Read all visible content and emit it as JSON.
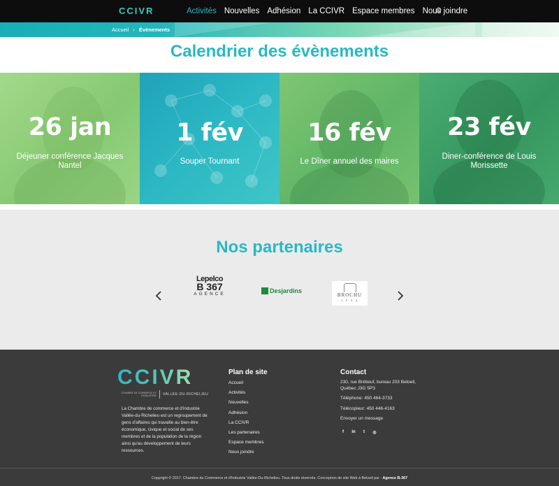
{
  "header": {
    "logo": "CCIVR",
    "nav": [
      {
        "label": "Activités",
        "active": true
      },
      {
        "label": "Nouvelles",
        "active": false
      },
      {
        "label": "Adhésion",
        "active": false
      },
      {
        "label": "La CCIVR",
        "active": false
      },
      {
        "label": "Espace membres",
        "active": false
      },
      {
        "label": "Nous joindre",
        "active": false
      }
    ],
    "search_icon": "search-icon"
  },
  "breadcrumb": {
    "home": "Accueil",
    "separator": "›",
    "current": "Évènements"
  },
  "calendar": {
    "title": "Calendrier des évènements",
    "events": [
      {
        "date": "26 jan",
        "name": "Déjeuner conférence Jacques Nantel",
        "tint": "#8fd07a"
      },
      {
        "date": "1 fév",
        "name": "Souper Tournant",
        "tint": "#2bb5c3"
      },
      {
        "date": "16 fév",
        "name": "Le Dîner annuel des maires",
        "tint": "#6fbf6a"
      },
      {
        "date": "23 fév",
        "name": "Diner-conférence de Louis Morissette",
        "tint": "#3fa56a"
      }
    ]
  },
  "partners": {
    "title": "Nos partenaires",
    "prev_icon": "chevron-left-icon",
    "next_icon": "chevron-right-icon",
    "logos": [
      {
        "name": "Lepelco B367 Agence",
        "line1": "Lepelco",
        "line2": "B 367",
        "line3": "AGENCE"
      },
      {
        "name": "Desjardins",
        "text": "Desjardins"
      },
      {
        "name": "Brochu",
        "line1": "BROCHU",
        "line2": "1 9 5 4"
      }
    ]
  },
  "footer": {
    "logo": "CCIVR",
    "logo_small": "CHAMBRE DE COMMERCE ET D'INDUSTRIE",
    "logo_region": "VALLÉE-DU-RICHELIEU",
    "about": "La Chambre de commerce et d'industrie Vallée-du-Richelieu est un regroupement de gens d'affaires qui travaille au bien-être économique, civique et social de ses membres et de la population de la région ainsi qu'au développement de leurs ressources.",
    "plan_title": "Plan de site",
    "plan_links": [
      "Accueil",
      "Activités",
      "Nouvelles",
      "Adhésion",
      "La CCIVR",
      "Les partenaires",
      "Espace membres",
      "Nous joindre"
    ],
    "contact_title": "Contact",
    "address_line1": "230, rue Brébeuf, bureau 203 Beloeil,",
    "address_line2": "Québec J3G 5P3",
    "phone": "Téléphone: 450 464-3733",
    "fax": "Télécopieur: 450 446-4163",
    "email": "Envoyer un message",
    "socials": [
      {
        "icon": "facebook-icon",
        "glyph": "f"
      },
      {
        "icon": "linkedin-icon",
        "glyph": "in"
      },
      {
        "icon": "twitter-icon",
        "glyph": "t"
      },
      {
        "icon": "instagram-icon",
        "glyph": "◎"
      }
    ],
    "copyright": "Copyright © 2017. Chambre du Commerce et d'Industrie Vallée-Du-Richelieu. Tous droits réservés. Conception de site Web à Beloeil par :",
    "agency": "Agence B-367"
  },
  "colors": {
    "accent": "#2ab8c4",
    "topbar": "#0d0d0d",
    "footer": "#3b3b3b",
    "partners_bg": "#ebebeb"
  }
}
